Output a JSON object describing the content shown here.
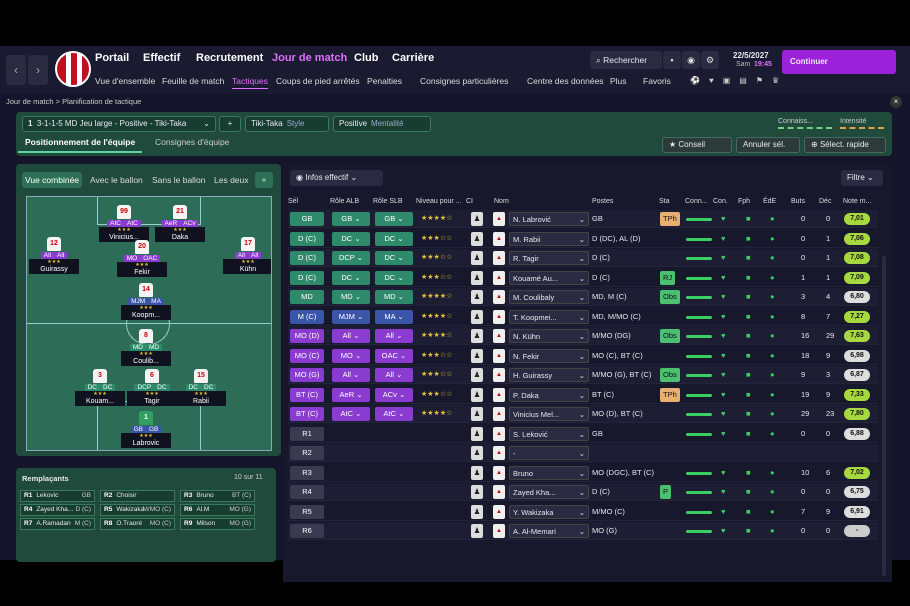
{
  "topbar": {
    "menu": [
      "Portail",
      "Effectif",
      "Recrutement",
      "Jour de match",
      "Club",
      "Carrière"
    ],
    "submenu": [
      "Vue d'ensemble",
      "Feuille de match",
      "Tactiques",
      "Coups de pied arrêtés",
      "Penalties",
      "Consignes particulières",
      "Centre des données",
      "Plus",
      "Favoris"
    ],
    "search": "Rechercher",
    "date": "22/5/2027",
    "day": "Sam",
    "time": "19:45",
    "continue": "Continuer"
  },
  "breadcrumb": {
    "a": "Jour de match",
    "b": "Planification de tactique"
  },
  "tactic": {
    "name": "3-1-1-5 MD Jeu large - Positive - Tiki-Taka",
    "num": "1",
    "style_val": "Tiki-Taka",
    "style_lbl": "Style",
    "ment_val": "Positive",
    "ment_lbl": "Mentalité",
    "conn": "Connaiss...",
    "intens": "Intensité"
  },
  "tabs": {
    "t1": "Positionnement de l'équipe",
    "t2": "Consignes d'équipe",
    "advice": "Conseil",
    "cancel": "Annuler sél.",
    "quick": "Sélect. rapide"
  },
  "pitch_tabs": [
    "Vue combinée",
    "Avec le ballon",
    "Sans le ballon",
    "Les deux"
  ],
  "players_pitch": [
    {
      "num": "99",
      "r1": "AtC",
      "r2": "AtC",
      "name": "Vinicius...",
      "c": "p"
    },
    {
      "num": "21",
      "r1": "AeR",
      "r2": "ACv",
      "name": "Daka",
      "c": "p"
    },
    {
      "num": "12",
      "r1": "All",
      "r2": "All",
      "name": "Guirassy",
      "c": "p"
    },
    {
      "num": "20",
      "r1": "MO",
      "r2": "OAC",
      "name": "Fekir",
      "c": "p"
    },
    {
      "num": "17",
      "r1": "All",
      "r2": "All",
      "name": "Kühn",
      "c": "p"
    },
    {
      "num": "14",
      "r1": "MJM",
      "r2": "MA",
      "name": "Koopm...",
      "c": "b"
    },
    {
      "num": "8",
      "r1": "MD",
      "r2": "MD",
      "name": "Coulib...",
      "c": "g"
    },
    {
      "num": "3",
      "r1": "DC",
      "r2": "DC",
      "name": "Kouam...",
      "c": "g"
    },
    {
      "num": "6",
      "r1": "DCP",
      "r2": "DC",
      "name": "Tagir",
      "c": "g"
    },
    {
      "num": "15",
      "r1": "DC",
      "r2": "DC",
      "name": "Rabii",
      "c": "g"
    },
    {
      "num": "1",
      "r1": "GB",
      "r2": "GB",
      "name": "Labrovic",
      "c": "b"
    }
  ],
  "subs": {
    "title": "Remplaçants",
    "count": "10 sur 11",
    "items": [
      {
        "r": "R1",
        "n": "Lekovic",
        "p": "GB"
      },
      {
        "r": "R2",
        "n": "Choisir",
        "p": ""
      },
      {
        "r": "R3",
        "n": "Bruno",
        "p": "BT (C)"
      },
      {
        "r": "R4",
        "n": "Zayed Kha...",
        "p": "D (C)"
      },
      {
        "r": "R5",
        "n": "Wakizaka",
        "p": "M/MO (C)"
      },
      {
        "r": "R6",
        "n": "Al.M",
        "p": "MO (G)"
      },
      {
        "r": "R7",
        "n": "A.Ramadan",
        "p": "M (C)"
      },
      {
        "r": "R8",
        "n": "O.Traoré",
        "p": "MO (C)"
      },
      {
        "r": "R9",
        "n": "Milson",
        "p": "MO (G)"
      }
    ]
  },
  "table": {
    "infos": "Infos effectif",
    "filter": "Filtre",
    "headers": [
      "Sél",
      "Rôle ALB",
      "Rôle SLB",
      "Niveau pour ...",
      "CI",
      "Nom",
      "Postes",
      "Sta",
      "Conn...",
      "Con.",
      "Fph",
      "ÉdE",
      "Buts",
      "Déc",
      "Note m..."
    ],
    "rows": [
      {
        "sel": "GB",
        "c": "t",
        "a": "GB",
        "b": "GB",
        "st": "★★★★☆",
        "name": "N. Labrović",
        "pos": "GB",
        "sta": "TPh",
        "buts": "0",
        "dec": "0",
        "note": "7,01"
      },
      {
        "sel": "D (C)",
        "c": "t",
        "a": "DC",
        "b": "DC",
        "st": "★★★☆☆",
        "name": "M. Rabii",
        "pos": "D (DC), AL (D)",
        "sta": "",
        "buts": "0",
        "dec": "1",
        "note": "7,06"
      },
      {
        "sel": "D (C)",
        "c": "t",
        "a": "DCP",
        "b": "DC",
        "st": "★★★☆☆",
        "name": "R. Tagir",
        "pos": "D (C)",
        "sta": "",
        "buts": "0",
        "dec": "1",
        "note": "7,08"
      },
      {
        "sel": "D (C)",
        "c": "t",
        "a": "DC",
        "b": "DC",
        "st": "★★★☆☆",
        "name": "Kouamé Au...",
        "pos": "D (C)",
        "sta": "RJ",
        "buts": "1",
        "dec": "1",
        "note": "7,09"
      },
      {
        "sel": "MD",
        "c": "g",
        "a": "MD",
        "b": "MD",
        "st": "★★★★☆",
        "name": "M. Coulibaly",
        "pos": "MD, M (C)",
        "sta": "Obs",
        "buts": "3",
        "dec": "4",
        "note": "6,80"
      },
      {
        "sel": "M (C)",
        "c": "b",
        "a": "MJM",
        "b": "MA",
        "st": "★★★★☆",
        "name": "T. Koopmei...",
        "pos": "MD, M/MO (C)",
        "sta": "",
        "buts": "8",
        "dec": "7",
        "note": "7,27"
      },
      {
        "sel": "MO (D)",
        "c": "p",
        "a": "All",
        "b": "All",
        "st": "★★★★☆",
        "name": "N. Kühn",
        "pos": "M/MO (DG)",
        "sta": "Obs",
        "buts": "16",
        "dec": "29",
        "note": "7,63"
      },
      {
        "sel": "MO (C)",
        "c": "p",
        "a": "MO",
        "b": "OAC",
        "st": "★★★☆☆",
        "name": "N. Fekir",
        "pos": "MO (C), BT (C)",
        "sta": "",
        "buts": "18",
        "dec": "9",
        "note": "6,98"
      },
      {
        "sel": "MO (G)",
        "c": "p",
        "a": "All",
        "b": "All",
        "st": "★★★☆☆",
        "name": "H. Guirassy",
        "pos": "M/MO (G), BT (C)",
        "sta": "Obs",
        "buts": "9",
        "dec": "3",
        "note": "6,87"
      },
      {
        "sel": "BT (C)",
        "c": "p",
        "a": "AeR",
        "b": "ACv",
        "st": "★★★☆☆",
        "name": "P. Daka",
        "pos": "BT (C)",
        "sta": "TPh",
        "buts": "19",
        "dec": "9",
        "note": "7,33"
      },
      {
        "sel": "BT (C)",
        "c": "p",
        "a": "AtC",
        "b": "AtC",
        "st": "★★★★☆",
        "name": "Vinicius Mel...",
        "pos": "MO (D), BT (C)",
        "sta": "",
        "buts": "29",
        "dec": "23",
        "note": "7,80"
      },
      {
        "sel": "R1",
        "c": "n",
        "a": "",
        "b": "",
        "st": "",
        "name": "S. Leković",
        "pos": "GB",
        "sta": "",
        "buts": "0",
        "dec": "0",
        "note": "6,88"
      },
      {
        "sel": "R2",
        "c": "n",
        "a": "",
        "b": "",
        "st": "",
        "name": "-",
        "pos": "",
        "sta": "",
        "buts": "",
        "dec": "",
        "note": ""
      },
      {
        "sel": "R3",
        "c": "n",
        "a": "",
        "b": "",
        "st": "",
        "name": "Bruno",
        "pos": "MO (DGC), BT (C)",
        "sta": "",
        "buts": "10",
        "dec": "6",
        "note": "7,02"
      },
      {
        "sel": "R4",
        "c": "n",
        "a": "",
        "b": "",
        "st": "",
        "name": "Zayed Kha...",
        "pos": "D (C)",
        "sta": "P",
        "buts": "0",
        "dec": "0",
        "note": "6,75"
      },
      {
        "sel": "R5",
        "c": "n",
        "a": "",
        "b": "",
        "st": "",
        "name": "Y. Wakizaka",
        "pos": "M/MO (C)",
        "sta": "",
        "buts": "7",
        "dec": "9",
        "note": "6,91"
      },
      {
        "sel": "R6",
        "c": "n",
        "a": "",
        "b": "",
        "st": "",
        "name": "A. Al-Memari",
        "pos": "MO (G)",
        "sta": "",
        "buts": "0",
        "dec": "0",
        "note": "-"
      }
    ]
  }
}
